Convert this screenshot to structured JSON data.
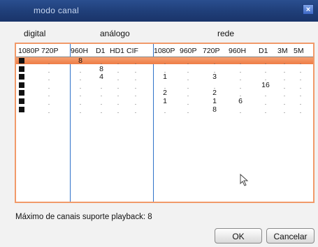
{
  "window": {
    "title": "modo canal",
    "close_glyph": "×",
    "close_icon": "close-icon"
  },
  "groups": {
    "digital": "digital",
    "analog": "análogo",
    "network": "rede"
  },
  "columns": [
    {
      "key": "c1080p_d",
      "label": "1080P"
    },
    {
      "key": "c720p_d",
      "label": "720P"
    },
    {
      "key": "c960h_a",
      "label": "960H"
    },
    {
      "key": "cd1_a",
      "label": "D1"
    },
    {
      "key": "chd1_a",
      "label": "HD1"
    },
    {
      "key": "ccif_a",
      "label": "CIF"
    },
    {
      "key": "c1080p_n",
      "label": "1080P"
    },
    {
      "key": "c960p_n",
      "label": "960P"
    },
    {
      "key": "c720p_n",
      "label": "720P"
    },
    {
      "key": "c960h_n",
      "label": "960H"
    },
    {
      "key": "cd1_n",
      "label": "D1"
    },
    {
      "key": "c3m_n",
      "label": "3M"
    },
    {
      "key": "c5m_n",
      "label": "5M"
    }
  ],
  "rows": [
    {
      "selected": true,
      "values": [
        "",
        "",
        "8",
        "",
        "",
        "",
        "",
        "",
        "",
        "",
        "",
        "",
        ""
      ]
    },
    {
      "selected": false,
      "values": [
        "",
        "",
        "",
        "8",
        "",
        "",
        "",
        "",
        "",
        "",
        "",
        "",
        ""
      ]
    },
    {
      "selected": false,
      "values": [
        "",
        "",
        "",
        "4",
        "",
        "",
        "1",
        "",
        "3",
        "",
        "",
        "",
        ""
      ]
    },
    {
      "selected": false,
      "values": [
        "",
        "",
        "",
        "",
        "",
        "",
        "",
        "",
        "",
        "",
        "16",
        "",
        ""
      ]
    },
    {
      "selected": false,
      "values": [
        "",
        "",
        "",
        "",
        "",
        "",
        "2",
        "",
        "2",
        "",
        "",
        "",
        ""
      ]
    },
    {
      "selected": false,
      "values": [
        "",
        "",
        "",
        "",
        "",
        "",
        "1",
        "",
        "1",
        "6",
        "",
        "",
        ""
      ]
    },
    {
      "selected": false,
      "values": [
        "",
        "",
        "",
        "",
        "",
        "",
        "",
        "",
        "8",
        "",
        "",
        "",
        ""
      ]
    }
  ],
  "empty_marker": ".",
  "footer": {
    "max_playback_text": "Máximo de canais suporte playback: 8"
  },
  "buttons": {
    "ok": "OK",
    "cancel": "Cancelar"
  },
  "colors": {
    "selection": "#ee7c45",
    "border": "#f19a6a",
    "divider": "#2f72c9",
    "title_bar": "#1f3e78"
  }
}
